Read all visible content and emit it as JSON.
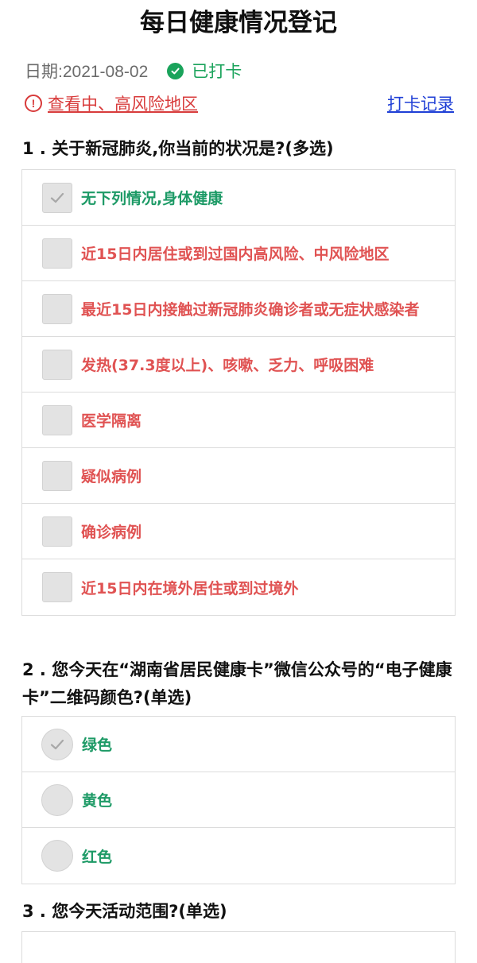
{
  "header": {
    "title": "每日健康情况登记"
  },
  "info": {
    "date_label": "日期:2021-08-02",
    "status_label": "已打卡",
    "risk_link": "查看中、高风险地区",
    "record_link": "打卡记录"
  },
  "colors": {
    "accent_green": "#1d9a66",
    "status_green": "#1aa35b",
    "warning_red": "#e05353",
    "link_blue": "#1f3fd6"
  },
  "q1": {
    "title": "1 . 关于新冠肺炎,你当前的状况是?(多选)",
    "options": [
      {
        "label": "无下列情况,身体健康",
        "checked": true
      },
      {
        "label": "近15日内居住或到过国内高风险、中风险地区",
        "checked": false
      },
      {
        "label": "最近15日内接触过新冠肺炎确诊者或无症状感染者",
        "checked": false
      },
      {
        "label": "发热(37.3度以上)、咳嗽、乏力、呼吸困难",
        "checked": false
      },
      {
        "label": "医学隔离",
        "checked": false
      },
      {
        "label": "疑似病例",
        "checked": false
      },
      {
        "label": "确诊病例",
        "checked": false
      },
      {
        "label": "近15日内在境外居住或到过境外",
        "checked": false
      }
    ]
  },
  "q2": {
    "title": "2 . 您今天在“湖南省居民健康卡”微信公众号的“电子健康卡”二维码颜色?(单选)",
    "options": [
      {
        "label": "绿色",
        "checked": true
      },
      {
        "label": "黄色",
        "checked": false
      },
      {
        "label": "红色",
        "checked": false
      }
    ]
  },
  "q3": {
    "title": "3 . 您今天活动范围?(单选)"
  }
}
